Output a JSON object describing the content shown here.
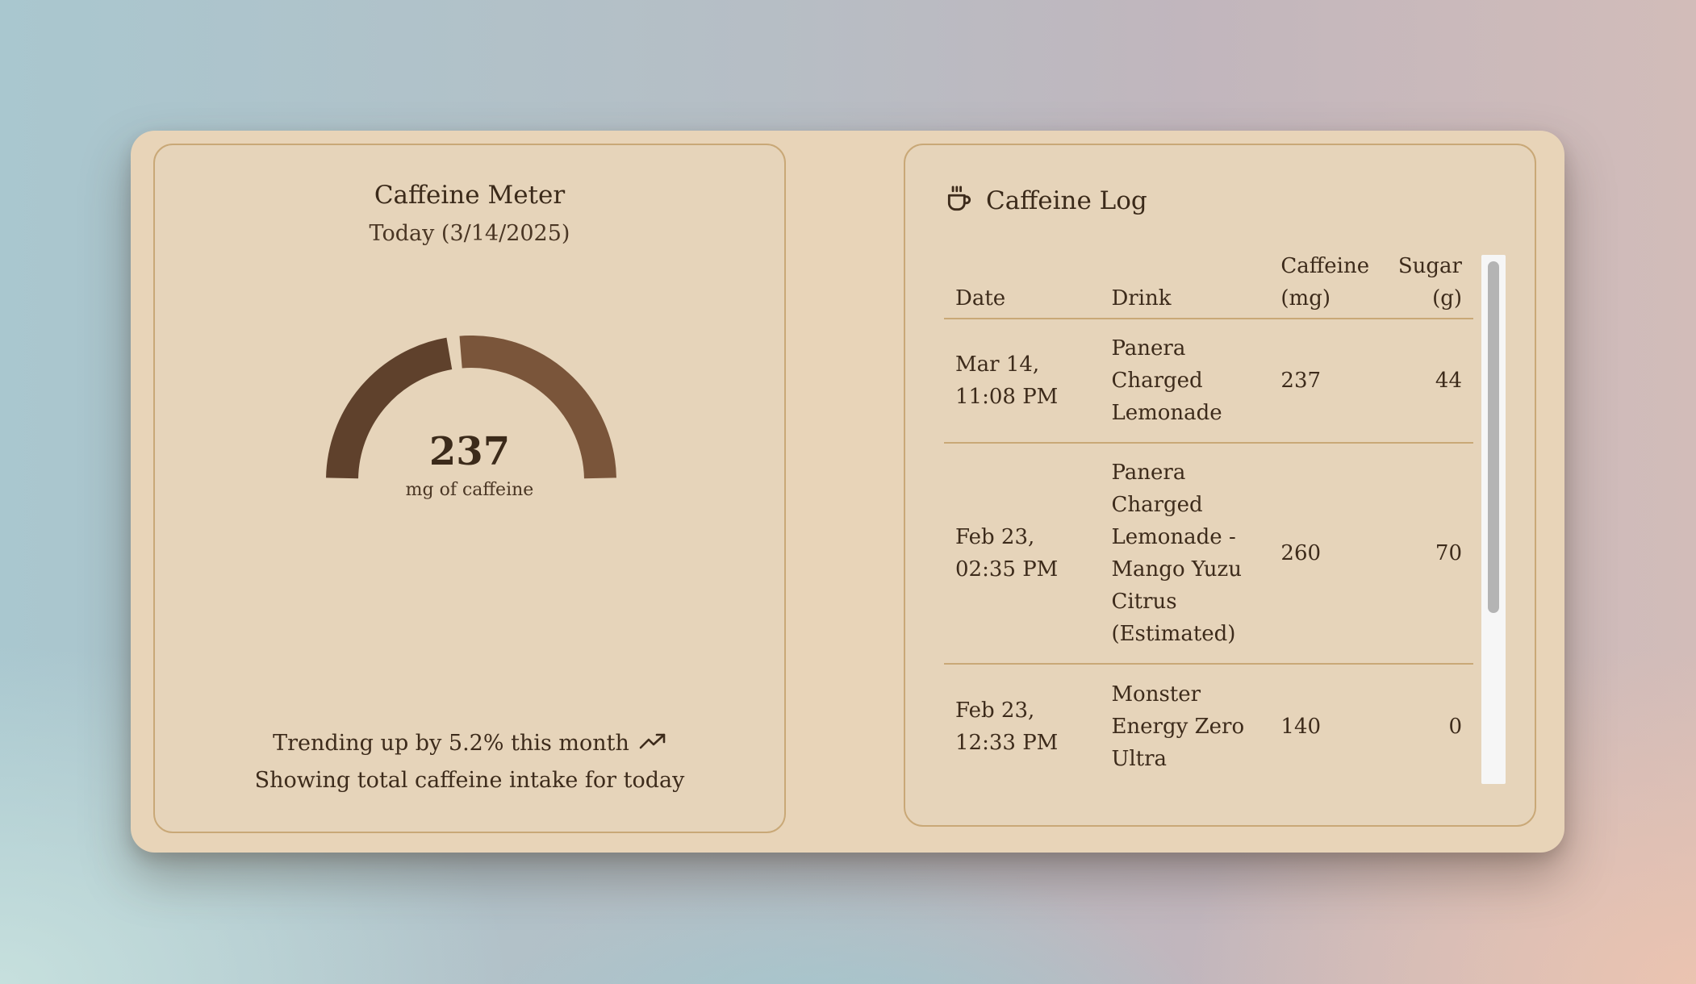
{
  "meter": {
    "title": "Caffeine Meter",
    "subtitle": "Today (3/14/2025)",
    "value": "237",
    "unit": "mg of caffeine",
    "fill_fraction": 0.46,
    "colors": {
      "filled": "#5f412c",
      "remaining": "#7a553a"
    },
    "trend_text": "Trending up by 5.2% this month",
    "trend_icon": "trending-up-icon",
    "footer": "Showing total caffeine intake for today"
  },
  "log": {
    "title": "Caffeine Log",
    "icon": "coffee-cup-icon",
    "columns": [
      "Date",
      "Drink",
      "Caffeine (mg)",
      "Sugar (g)"
    ],
    "rows": [
      {
        "date": "Mar 14, 11:08 PM",
        "drink": "Panera Charged Lemonade",
        "caffeine": "237",
        "sugar": "44"
      },
      {
        "date": "Feb 23, 02:35 PM",
        "drink": "Panera Charged Lemonade - Mango Yuzu Citrus (Estimated)",
        "caffeine": "260",
        "sugar": "70"
      },
      {
        "date": "Feb 23, 12:33 PM",
        "drink": "Monster Energy Zero Ultra",
        "caffeine": "140",
        "sugar": "0"
      }
    ]
  },
  "colors": {
    "panel": "#e6d4ba",
    "border": "#c9a877",
    "text": "#3d2b1b"
  }
}
